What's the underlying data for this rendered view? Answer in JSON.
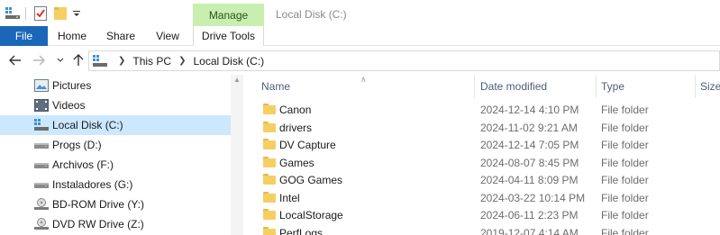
{
  "title_bar": {
    "manage_tab": "Manage",
    "window_title": "Local Disk (C:)"
  },
  "ribbon": {
    "tabs": [
      "File",
      "Home",
      "Share",
      "View",
      "Drive Tools"
    ]
  },
  "address_bar": {
    "crumbs": [
      "This PC",
      "Local Disk (C:)"
    ]
  },
  "nav_pane": {
    "items": [
      {
        "label": "Pictures",
        "icon": "pictures-icon"
      },
      {
        "label": "Videos",
        "icon": "videos-icon"
      },
      {
        "label": "Local Disk (C:)",
        "icon": "windows-drive-icon",
        "selected": true
      },
      {
        "label": "Progs (D:)",
        "icon": "drive-icon"
      },
      {
        "label": "Archivos (F:)",
        "icon": "drive-icon"
      },
      {
        "label": "Instaladores (G:)",
        "icon": "drive-icon"
      },
      {
        "label": "BD-ROM Drive (Y:)",
        "icon": "optical-drive-icon"
      },
      {
        "label": "DVD RW Drive (Z:)",
        "icon": "optical-drive-icon"
      }
    ]
  },
  "file_list": {
    "columns": [
      "Name",
      "Date modified",
      "Type",
      "Size"
    ],
    "rows": [
      {
        "name": "Canon",
        "date": "2024-12-14 4:10 PM",
        "type": "File folder"
      },
      {
        "name": "drivers",
        "date": "2024-11-02 9:21 AM",
        "type": "File folder"
      },
      {
        "name": "DV Capture",
        "date": "2024-12-14 7:05 PM",
        "type": "File folder"
      },
      {
        "name": "Games",
        "date": "2024-08-07 8:45 PM",
        "type": "File folder"
      },
      {
        "name": "GOG Games",
        "date": "2024-04-11 8:09 PM",
        "type": "File folder"
      },
      {
        "name": "Intel",
        "date": "2024-03-22 10:14 PM",
        "type": "File folder"
      },
      {
        "name": "LocalStorage",
        "date": "2024-06-11 2:23 PM",
        "type": "File folder"
      },
      {
        "name": "PerfLogs",
        "date": "2019-12-07 4:14 AM",
        "type": "File folder"
      }
    ]
  },
  "colors": {
    "file_tab": "#1a67b8",
    "manage_tab": "#c8efb0",
    "selection": "#cce8ff",
    "folder": "#f6cf63"
  }
}
